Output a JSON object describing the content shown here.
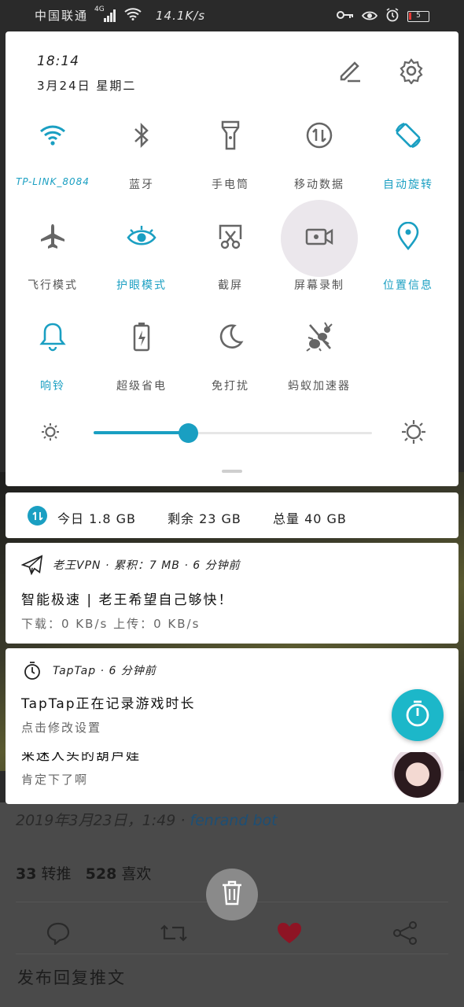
{
  "status_bar": {
    "carrier": "中国联通",
    "network": "4G",
    "speed": "14.1K/s",
    "battery": "5",
    "icons": [
      "signal-icon",
      "wifi-icon",
      "key-icon",
      "eye-icon",
      "alarm-icon",
      "battery-icon"
    ]
  },
  "quick_settings": {
    "time": "18:14",
    "date": "3月24日 星期二",
    "tiles": [
      {
        "name": "wifi",
        "label": "TP-LINK_8084",
        "icon": "wifi-icon",
        "active": true
      },
      {
        "name": "bluetooth",
        "label": "蓝牙",
        "icon": "bluetooth-icon",
        "active": false
      },
      {
        "name": "flashlight",
        "label": "手电筒",
        "icon": "flashlight-icon",
        "active": false
      },
      {
        "name": "mobile-data",
        "label": "移动数据",
        "icon": "mobile-data-icon",
        "active": false
      },
      {
        "name": "auto-rotate",
        "label": "自动旋转",
        "icon": "rotate-icon",
        "active": true
      },
      {
        "name": "airplane",
        "label": "飞行模式",
        "icon": "airplane-icon",
        "active": false
      },
      {
        "name": "eye-comfort",
        "label": "护眼模式",
        "icon": "eye-icon",
        "active": true
      },
      {
        "name": "screenshot",
        "label": "截屏",
        "icon": "scissors-icon",
        "active": false
      },
      {
        "name": "screen-record",
        "label": "屏幕录制",
        "icon": "video-camera-icon",
        "active": false,
        "pressed": true
      },
      {
        "name": "location",
        "label": "位置信息",
        "icon": "location-pin-icon",
        "active": true
      },
      {
        "name": "ring",
        "label": "响铃",
        "icon": "bell-icon",
        "active": true
      },
      {
        "name": "power-saving",
        "label": "超级省电",
        "icon": "battery-bolt-icon",
        "active": false
      },
      {
        "name": "do-not-disturb",
        "label": "免打扰",
        "icon": "moon-icon",
        "active": false
      },
      {
        "name": "ant-accelerator",
        "label": "蚂蚁加速器",
        "icon": "ant-icon",
        "active": false
      }
    ],
    "brightness": 0.34
  },
  "data_usage": {
    "today": "今日 1.8 GB",
    "remaining": "剩余 23 GB",
    "total": "总量 40 GB"
  },
  "notifications": {
    "vpn": {
      "header": "老王VPN · 累积：7 MB · 6 分钟前",
      "title": "智能极速 | 老王希望自己够快！",
      "subtitle": "下载：0 KB/s  上传：0 KB/s"
    },
    "taptap": {
      "header": "TapTap · 6 分钟前",
      "title": "TapTap正在记录游戏时长",
      "subtitle": "点击修改设置"
    },
    "third": {
      "title": "来迷人头的葫芦娃",
      "subtitle": "肯定下了啊"
    }
  },
  "background": {
    "meta": "2019年3月23日，1:49",
    "meta_user": "fenrand bot",
    "retweets": "33",
    "retweets_label": "转推",
    "likes": "528",
    "likes_label": "喜欢",
    "reply_placeholder": "发布回复推文"
  },
  "colors": {
    "accent": "#1a9fc2",
    "inactive_icon": "#666666",
    "fab": "#1cb7c9",
    "like": "#b0172a"
  }
}
